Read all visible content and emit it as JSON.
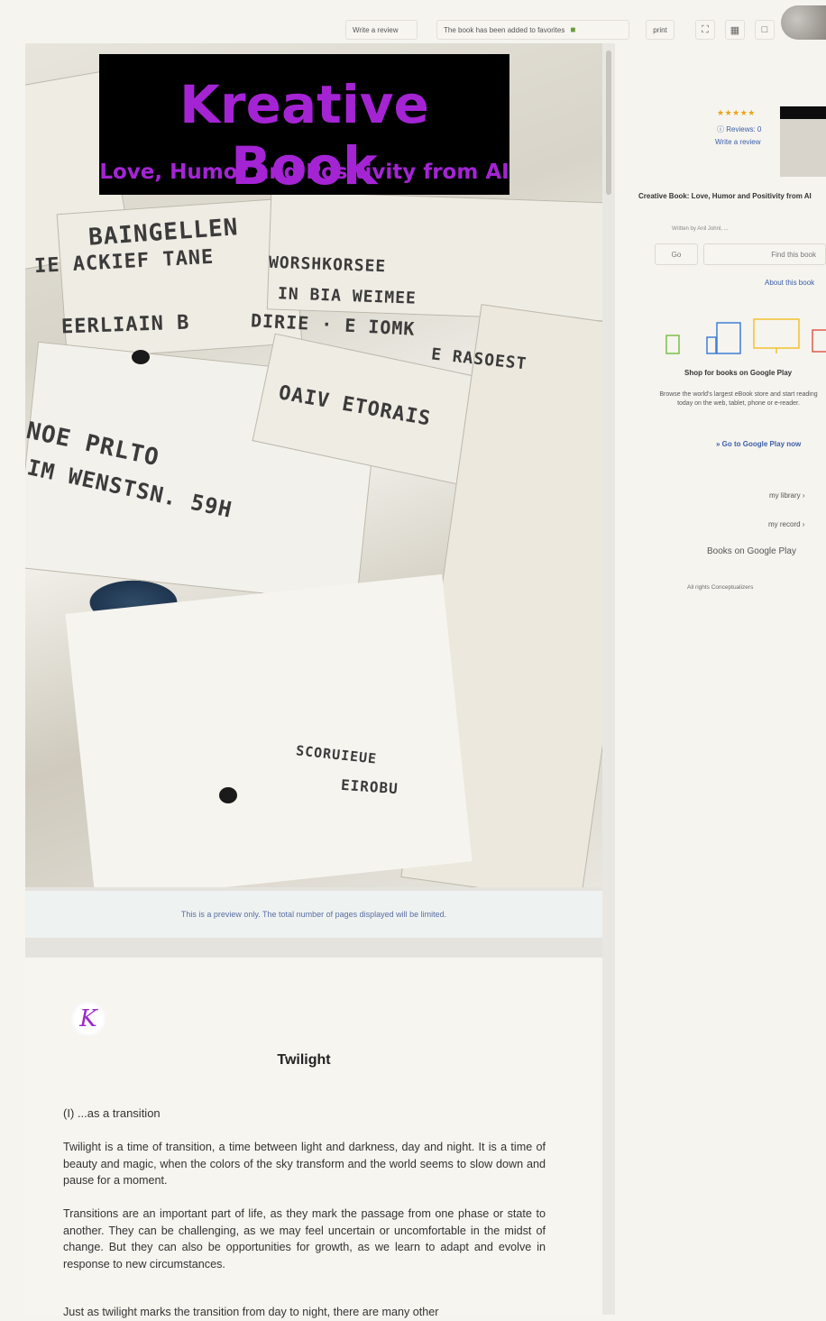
{
  "topbar": {
    "breadcrumbs": "",
    "write_review": "Write a review",
    "added_to_favorites": "The book has been added to favorites",
    "print": "print",
    "fullscreen_icon": "expand-icon",
    "layout_icon": "two-page-icon",
    "single_page_icon": "single-page-icon"
  },
  "cover": {
    "title": "Kreative Book",
    "subtitle": "Love, Humor and Positivity from AI"
  },
  "preview_note": "This is a preview only. The total number of pages displayed will be limited.",
  "page": {
    "logo_letter": "K",
    "heading": "Twilight",
    "subheading": "(I) ...as a transition",
    "paragraphs": [
      "Twilight is a time of transition, a time between light and darkness, day and night. It is a time of beauty and magic, when the colors of the sky transform and the world seems to slow down and pause for a moment.",
      "Transitions are an important part of life, as they mark the passage from one phase or state to another. They can be challenging, as we may feel uncertain or uncomfortable in the midst of change. But they can also be opportunities for growth, as we learn to adapt and evolve in response to new circumstances.",
      "Just as twilight marks the transition from day to night, there are many other"
    ]
  },
  "right_panel": {
    "rating_stars": "★★★★★",
    "reviews": "Reviews: 0",
    "write_review": "Write a review",
    "book_title": "Creative Book: Love, Humor and Positivity from AI",
    "book_meta": "Written by Anil Johnl, ...",
    "go_button": "Go",
    "search_placeholder": "Find this book",
    "about_link": "About this book",
    "shop_heading": "Shop for books on Google Play",
    "shop_text": "Browse the world's largest eBook store and start reading today on the web, tablet, phone or e-reader.",
    "go_to_play": "» Go to Google Play now",
    "my_library": "my library",
    "my_history": "my record",
    "books_on_google_play": "Books on Google Play",
    "footer": "All rights Conceptualizers"
  },
  "colors": {
    "accent_purple": "#a424d4",
    "link_blue": "#3b5ea8",
    "star_yellow": "#e8a317"
  }
}
